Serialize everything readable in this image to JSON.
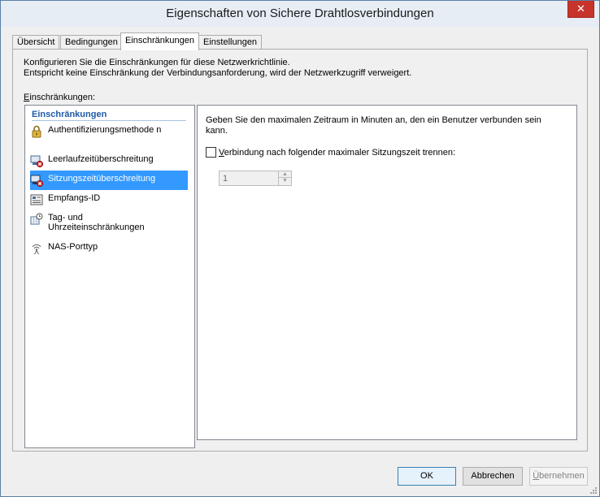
{
  "window": {
    "title": "Eigenschaften von Sichere Drahtlosverbindungen",
    "close_label": "✕"
  },
  "tabs": [
    {
      "label": "Übersicht"
    },
    {
      "label": "Bedingungen"
    },
    {
      "label": "Einschränkungen",
      "active": true
    },
    {
      "label": "Einstellungen"
    }
  ],
  "panel": {
    "desc_line1": "Konfigurieren Sie die Einschränkungen für diese Netzwerkrichtlinie.",
    "desc_line2": "Entspricht keine Einschränkung der Verbindungsanforderung, wird der Netzwerkzugriff verweigert.",
    "section_label_prefix": "E",
    "section_label_rest": "inschränkungen:"
  },
  "nav": {
    "group_header": "Einschränkungen",
    "items": [
      {
        "label": "Authentifizierungsmethode n",
        "icon": "lock-icon"
      },
      {
        "label": "Leerlaufzeitüberschreitung",
        "icon": "idle-timeout-icon"
      },
      {
        "label": "Sitzungszeitüberschreitung",
        "icon": "session-timeout-icon",
        "selected": true
      },
      {
        "label": "Empfangs-ID",
        "icon": "called-station-id-icon"
      },
      {
        "label": "Tag- und Uhrzeiteinschränkungen",
        "icon": "calendar-clock-icon"
      },
      {
        "label": "NAS-Porttyp",
        "icon": "nas-port-icon"
      }
    ]
  },
  "content": {
    "description": "Geben Sie den maximalen Zeitraum in Minuten an, den ein Benutzer verbunden sein kann.",
    "checkbox_label_prefix": "V",
    "checkbox_label_rest": "erbindung nach folgender maximaler Sitzungszeit trennen:",
    "checkbox_checked": false,
    "spin_value": "1"
  },
  "buttons": {
    "ok": "OK",
    "cancel": "Abbrechen",
    "apply_prefix": "Ü",
    "apply_rest": "bernehmen"
  },
  "colors": {
    "selection": "#3399ff",
    "group_header": "#1e5aa8",
    "close_button": "#c7342b"
  }
}
